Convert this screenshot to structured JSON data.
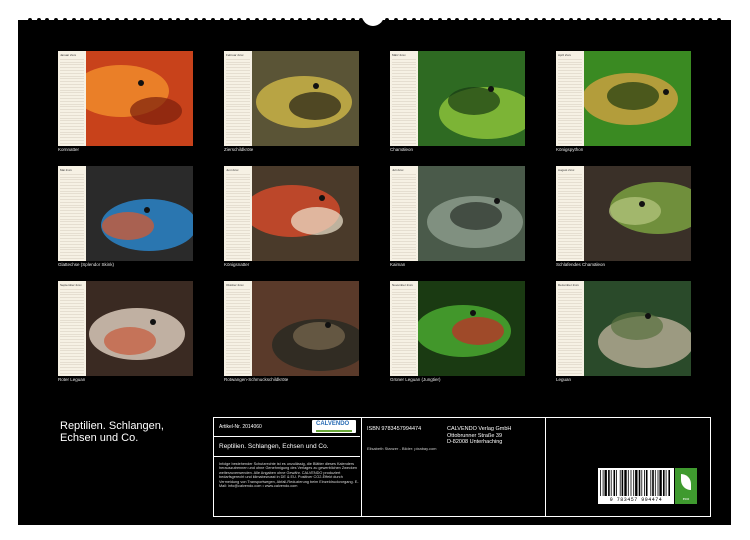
{
  "calendar": {
    "title": "Reptilien. Schlangen, Echsen und Co.",
    "months": [
      {
        "month": "Januar 2xxx",
        "caption": "Kornnatter",
        "colors": [
          "#c8421b",
          "#f08a2a",
          "#7a1f0c"
        ]
      },
      {
        "month": "Februar 2xxx",
        "caption": "Zierschildkröte",
        "colors": [
          "#5a5436",
          "#c9b347",
          "#222015"
        ]
      },
      {
        "month": "März 2xxx",
        "caption": "Chamäleon",
        "colors": [
          "#2e6a22",
          "#8ac13a",
          "#183a12"
        ]
      },
      {
        "month": "April 2xxx",
        "caption": "Königspython",
        "colors": [
          "#3a8a22",
          "#c9a040",
          "#1f3a10"
        ]
      },
      {
        "month": "Mai 2xxx",
        "caption": "Glattechse (Splendor Skink)",
        "colors": [
          "#2a2a2a",
          "#2a84c8",
          "#e0582a"
        ]
      },
      {
        "month": "Juni 2xxx",
        "caption": "Königsnatter",
        "colors": [
          "#4a3a2a",
          "#d04a2a",
          "#efe6d0"
        ]
      },
      {
        "month": "Juli 2xxx",
        "caption": "Kaiman",
        "colors": [
          "#4a5a4a",
          "#8a9a8a",
          "#2a302a"
        ]
      },
      {
        "month": "August 2xxx",
        "caption": "Schlafendes Chamäleon",
        "colors": [
          "#3a3028",
          "#7aa040",
          "#b8c880"
        ]
      },
      {
        "month": "September 2xxx",
        "caption": "Roter Leguan",
        "colors": [
          "#3a2a22",
          "#d8c8b8",
          "#c85a3a"
        ]
      },
      {
        "month": "Oktober 2xxx",
        "caption": "Rotwangen-Schmuckschildkröte",
        "colors": [
          "#5a3a2a",
          "#2a2a22",
          "#7a6a50"
        ]
      },
      {
        "month": "November 2xxx",
        "caption": "Grüner Leguan (Jungtier)",
        "colors": [
          "#1a3a12",
          "#4aa830",
          "#c82a2a"
        ]
      },
      {
        "month": "Dezember 2xxx",
        "caption": "Leguan",
        "colors": [
          "#2a4a2a",
          "#b0a890",
          "#5a7040"
        ]
      }
    ]
  },
  "footer": {
    "article": "Artikel-Nr. 2014060",
    "logo_text": "CALVENDO",
    "small_title": "Reptilien. Schlangen, Echsen und Co.",
    "legal": "Infolge bestehender Schutzrechte ist es unzulässig, die Blätter dieses Kalenders herauszutrennen und ohne Genehmigung des Verlages zu gewerblichen Zwecken weiterzuverwenden. Alle Angaben ohne Gewähr. CALVENDO produziert bedarfsgerecht und klimabewusst in DE & EU. Positiver CO2-Effekt durch Vermeidung von Transportwegen, Abfall-Reduzierung beim Einzeldruckvorgang. E-Mail: info@calvendo.com • www.calvendo.com",
    "isbn": "ISBN 9783457994474",
    "publisher_name": "CALVENDO Verlag GmbH",
    "publisher_street": "Ottobrunner Straße 39",
    "publisher_city": "D-82008 Unterhaching",
    "credit": "Elisabeth Stanzer - Bilder: pixabay.com",
    "barcode_number": "9 783457 994474",
    "eco_label": "eco"
  }
}
